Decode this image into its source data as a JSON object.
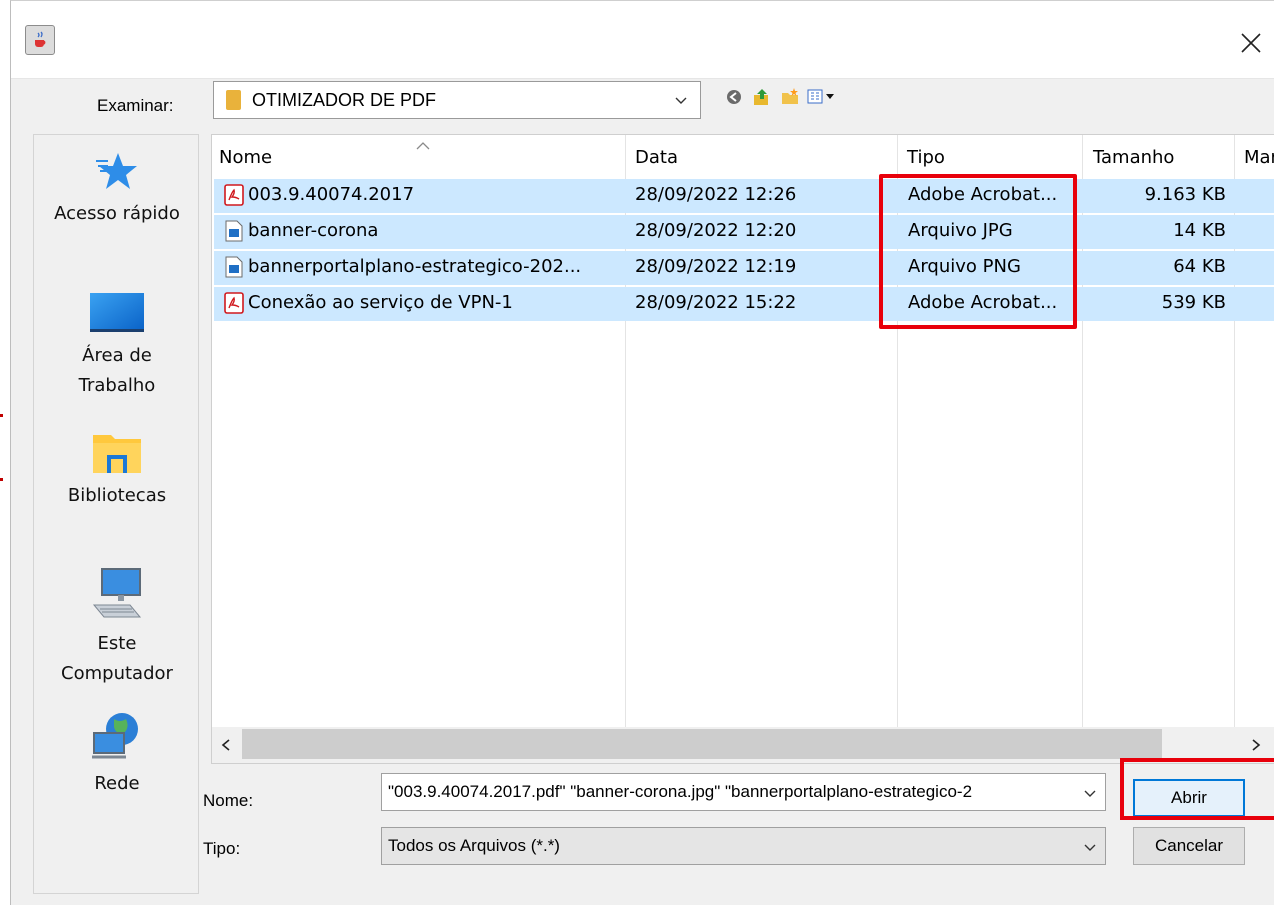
{
  "dialog": {
    "title_icon": "java-cup-icon",
    "close_icon": "close-icon"
  },
  "look_in": {
    "label": "Examinar:",
    "value": "OTIMIZADOR DE PDF",
    "toolbar_icons": [
      "back-icon",
      "up-folder-icon",
      "new-folder-icon",
      "view-menu-icon"
    ]
  },
  "places": [
    {
      "label_lines": [
        "Acesso rápido"
      ],
      "icon": "quick-access-star-icon"
    },
    {
      "label_lines": [
        "Área de",
        "Trabalho"
      ],
      "icon": "desktop-icon"
    },
    {
      "label_lines": [
        "Bibliotecas"
      ],
      "icon": "libraries-folder-icon"
    },
    {
      "label_lines": [
        "Este",
        "Computador"
      ],
      "icon": "computer-icon"
    },
    {
      "label_lines": [
        "Rede"
      ],
      "icon": "network-globe-icon"
    }
  ],
  "file_list": {
    "columns": [
      "Nome",
      "Data",
      "Tipo",
      "Tamanho",
      "Mar"
    ],
    "rows": [
      {
        "name": "003.9.40074.2017",
        "date": "28/09/2022 12:26",
        "type": "Adobe Acrobat...",
        "size": "9.163 KB",
        "icon": "pdf-file-icon"
      },
      {
        "name": "banner-corona",
        "date": "28/09/2022 12:20",
        "type": "Arquivo JPG",
        "size": "14 KB",
        "icon": "image-file-icon"
      },
      {
        "name": "bannerportalplano-estrategico-202...",
        "date": "28/09/2022 12:19",
        "type": "Arquivo PNG",
        "size": "64 KB",
        "icon": "image-file-icon"
      },
      {
        "name": "Conexão ao serviço de VPN-1",
        "date": "28/09/2022 15:22",
        "type": "Adobe Acrobat...",
        "size": "539 KB",
        "icon": "pdf-file-icon"
      }
    ]
  },
  "file_name": {
    "label": "Nome:",
    "value": "\"003.9.40074.2017.pdf\" \"banner-corona.jpg\" \"bannerportalplano-estrategico-2"
  },
  "file_type": {
    "label": "Tipo:",
    "value": "Todos os Arquivos (*.*)"
  },
  "buttons": {
    "open": "Abrir",
    "cancel": "Cancelar"
  },
  "colors": {
    "selection": "#cce8ff",
    "annotation_red": "#e8000b"
  }
}
